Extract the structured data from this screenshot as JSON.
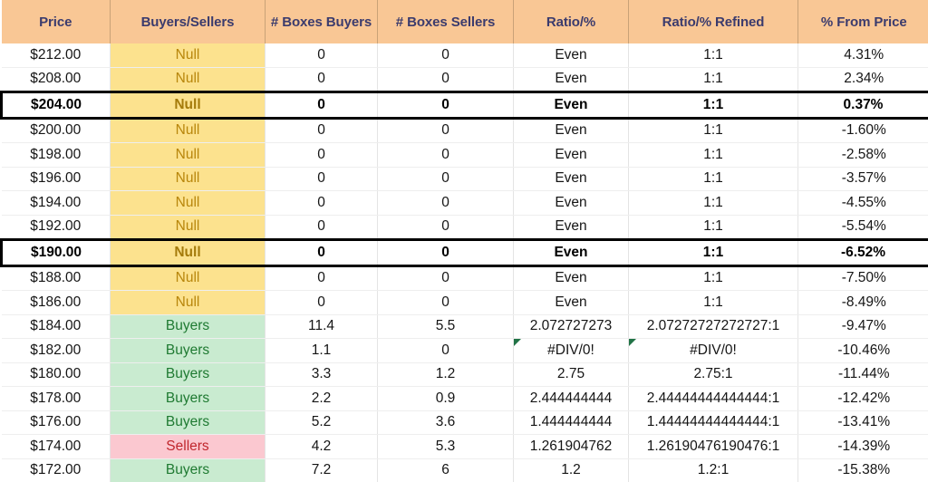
{
  "table": {
    "columns": [
      {
        "key": "price",
        "label": "Price"
      },
      {
        "key": "bs",
        "label": "Buyers/Sellers"
      },
      {
        "key": "bb",
        "label": "# Boxes Buyers"
      },
      {
        "key": "bsl",
        "label": "# Boxes Sellers"
      },
      {
        "key": "ratio",
        "label": "Ratio/%"
      },
      {
        "key": "refined",
        "label": "Ratio/% Refined"
      },
      {
        "key": "pct",
        "label": "% From Price"
      }
    ],
    "colors": {
      "header_bg": "#f9c795",
      "header_text": "#3b3b6d",
      "null_bg": "#fce28e",
      "null_text": "#b8860b",
      "buyers_bg": "#c9ebd0",
      "buyers_text": "#1f7a32",
      "sellers_bg": "#fbc8d0",
      "sellers_text": "#c0272d",
      "highlight_border": "#000000",
      "comment_marker": "#217346"
    },
    "rows": [
      {
        "price": "$212.00",
        "bs": "Null",
        "state": "null",
        "bb": "0",
        "bsl": "0",
        "ratio": "Even",
        "refined": "1:1",
        "pct": "4.31%",
        "highlight": false,
        "comment": false
      },
      {
        "price": "$208.00",
        "bs": "Null",
        "state": "null",
        "bb": "0",
        "bsl": "0",
        "ratio": "Even",
        "refined": "1:1",
        "pct": "2.34%",
        "highlight": false,
        "comment": false
      },
      {
        "price": "$204.00",
        "bs": "Null",
        "state": "null",
        "bb": "0",
        "bsl": "0",
        "ratio": "Even",
        "refined": "1:1",
        "pct": "0.37%",
        "highlight": true,
        "comment": false
      },
      {
        "price": "$200.00",
        "bs": "Null",
        "state": "null",
        "bb": "0",
        "bsl": "0",
        "ratio": "Even",
        "refined": "1:1",
        "pct": "-1.60%",
        "highlight": false,
        "comment": false
      },
      {
        "price": "$198.00",
        "bs": "Null",
        "state": "null",
        "bb": "0",
        "bsl": "0",
        "ratio": "Even",
        "refined": "1:1",
        "pct": "-2.58%",
        "highlight": false,
        "comment": false
      },
      {
        "price": "$196.00",
        "bs": "Null",
        "state": "null",
        "bb": "0",
        "bsl": "0",
        "ratio": "Even",
        "refined": "1:1",
        "pct": "-3.57%",
        "highlight": false,
        "comment": false
      },
      {
        "price": "$194.00",
        "bs": "Null",
        "state": "null",
        "bb": "0",
        "bsl": "0",
        "ratio": "Even",
        "refined": "1:1",
        "pct": "-4.55%",
        "highlight": false,
        "comment": false
      },
      {
        "price": "$192.00",
        "bs": "Null",
        "state": "null",
        "bb": "0",
        "bsl": "0",
        "ratio": "Even",
        "refined": "1:1",
        "pct": "-5.54%",
        "highlight": false,
        "comment": false
      },
      {
        "price": "$190.00",
        "bs": "Null",
        "state": "null",
        "bb": "0",
        "bsl": "0",
        "ratio": "Even",
        "refined": "1:1",
        "pct": "-6.52%",
        "highlight": true,
        "comment": false
      },
      {
        "price": "$188.00",
        "bs": "Null",
        "state": "null",
        "bb": "0",
        "bsl": "0",
        "ratio": "Even",
        "refined": "1:1",
        "pct": "-7.50%",
        "highlight": false,
        "comment": false
      },
      {
        "price": "$186.00",
        "bs": "Null",
        "state": "null",
        "bb": "0",
        "bsl": "0",
        "ratio": "Even",
        "refined": "1:1",
        "pct": "-8.49%",
        "highlight": false,
        "comment": false
      },
      {
        "price": "$184.00",
        "bs": "Buyers",
        "state": "buyers",
        "bb": "11.4",
        "bsl": "5.5",
        "ratio": "2.072727273",
        "refined": "2.07272727272727:1",
        "pct": "-9.47%",
        "highlight": false,
        "comment": false
      },
      {
        "price": "$182.00",
        "bs": "Buyers",
        "state": "buyers",
        "bb": "1.1",
        "bsl": "0",
        "ratio": "#DIV/0!",
        "refined": "#DIV/0!",
        "pct": "-10.46%",
        "highlight": false,
        "comment": true
      },
      {
        "price": "$180.00",
        "bs": "Buyers",
        "state": "buyers",
        "bb": "3.3",
        "bsl": "1.2",
        "ratio": "2.75",
        "refined": "2.75:1",
        "pct": "-11.44%",
        "highlight": false,
        "comment": false
      },
      {
        "price": "$178.00",
        "bs": "Buyers",
        "state": "buyers",
        "bb": "2.2",
        "bsl": "0.9",
        "ratio": "2.444444444",
        "refined": "2.44444444444444:1",
        "pct": "-12.42%",
        "highlight": false,
        "comment": false
      },
      {
        "price": "$176.00",
        "bs": "Buyers",
        "state": "buyers",
        "bb": "5.2",
        "bsl": "3.6",
        "ratio": "1.444444444",
        "refined": "1.44444444444444:1",
        "pct": "-13.41%",
        "highlight": false,
        "comment": false
      },
      {
        "price": "$174.00",
        "bs": "Sellers",
        "state": "sellers",
        "bb": "4.2",
        "bsl": "5.3",
        "ratio": "1.261904762",
        "refined": "1.26190476190476:1",
        "pct": "-14.39%",
        "highlight": false,
        "comment": false
      },
      {
        "price": "$172.00",
        "bs": "Buyers",
        "state": "buyers",
        "bb": "7.2",
        "bsl": "6",
        "ratio": "1.2",
        "refined": "1.2:1",
        "pct": "-15.38%",
        "highlight": false,
        "comment": false
      }
    ]
  }
}
